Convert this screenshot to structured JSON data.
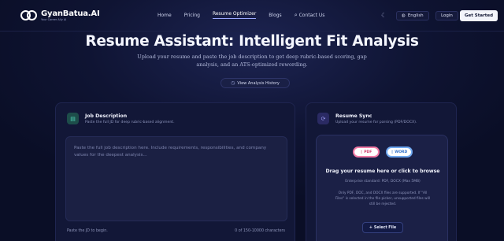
{
  "brand": {
    "name": "GyanBatua.AI",
    "tagline": "Your Career Ally AI"
  },
  "nav": {
    "links": [
      {
        "label": "Home"
      },
      {
        "label": "Pricing"
      },
      {
        "label": "Resume Optimizer",
        "active": true
      },
      {
        "label": "Blogs"
      },
      {
        "label": "Contact Us",
        "icon": "search-icon"
      }
    ],
    "language": "English",
    "login": "Login",
    "get_started": "Get Started"
  },
  "hero": {
    "title": "Resume Assistant: Intelligent Fit Analysis",
    "subtitle": "Upload your resume and paste the job description to get deep rubric-based scoring, gap analysis, and an ATS-optimized rewording.",
    "history_button": "View Analysis History"
  },
  "job_card": {
    "title": "Job Description",
    "description": "Paste the full JD for deep rubric-based alignment.",
    "placeholder": "Paste the full job description here. Include requirements, responsibilities, and company values for the deepest analysis...",
    "footer_left": "Paste the JD to begin.",
    "footer_right": "0 of 150-10000 characters"
  },
  "resume_card": {
    "title": "Resume Sync",
    "description": "Upload your resume for parsing (PDF/DOCX).",
    "pdf_label": "PDF",
    "word_label": "WORD",
    "drop_title": "Drag your resume here or click to browse",
    "note_standard": "Enterprise standard: PDF, DOCX (Max 5MB)",
    "note_support": "Only PDF, DOC, and DOCX files are supported. If \"All Files\" is selected in the file picker, unsupported files will still be rejected.",
    "select_button": "Select File"
  },
  "colors": {
    "background": "#0b1029",
    "card": "#121737",
    "accent_teal": "#4fd1b6",
    "accent_purple": "#9a9cf3",
    "pdf_pink": "#f07aa5",
    "word_blue": "#6fa8f0"
  }
}
